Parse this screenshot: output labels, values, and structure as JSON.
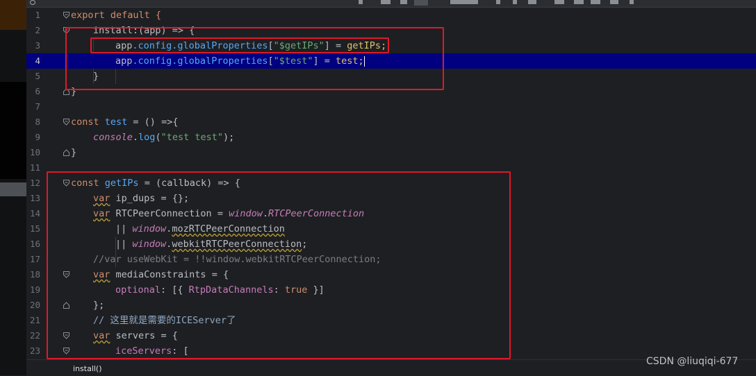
{
  "editor": {
    "current_line": 4,
    "lines": [
      {
        "n": "1"
      },
      {
        "n": "2"
      },
      {
        "n": "3"
      },
      {
        "n": "4"
      },
      {
        "n": "5"
      },
      {
        "n": "6"
      },
      {
        "n": "7"
      },
      {
        "n": "8"
      },
      {
        "n": "9"
      },
      {
        "n": "10"
      },
      {
        "n": "11"
      },
      {
        "n": "12"
      },
      {
        "n": "13"
      },
      {
        "n": "14"
      },
      {
        "n": "15"
      },
      {
        "n": "16"
      },
      {
        "n": "17"
      },
      {
        "n": "18"
      },
      {
        "n": "19"
      },
      {
        "n": "20"
      },
      {
        "n": "21"
      },
      {
        "n": "22"
      },
      {
        "n": "23"
      }
    ],
    "code": {
      "l1": [
        "export default {"
      ],
      "l2": [
        "install:(app) => {"
      ],
      "l3": [
        "app",
        ".config.",
        "globalProperties",
        "[",
        "\"$getIPs\"",
        "] = ",
        "getIPs",
        ";"
      ],
      "l4": [
        "app",
        ".config.",
        "globalProperties",
        "[",
        "\"$test\"",
        "] = ",
        "test",
        ";"
      ],
      "l5": [
        "}"
      ],
      "l6": [
        "}"
      ],
      "l8": [
        "const ",
        "test",
        " = () =>{"
      ],
      "l9": [
        "console",
        ".",
        "log",
        "(",
        "\"test test\"",
        ");"
      ],
      "l10": [
        "}"
      ],
      "l12": [
        "const ",
        "getIPs",
        " = (callback) => {"
      ],
      "l13": [
        "var",
        " ip_dups = {};"
      ],
      "l14": [
        "var",
        " RTCPeerConnection = ",
        "window",
        ".",
        "RTCPeerConnection"
      ],
      "l15": [
        "|| ",
        "window",
        ".",
        "mozRTCPeerConnection"
      ],
      "l16": [
        "|| ",
        "window",
        ".",
        "webkitRTCPeerConnection",
        ";"
      ],
      "l17": [
        "//var useWebKit = !!window.webkitRTCPeerConnection;"
      ],
      "l18": [
        "var",
        " mediaConstraints = {"
      ],
      "l19": [
        "optional",
        ": [{ ",
        "RtpDataChannels",
        ": ",
        "true",
        " }]"
      ],
      "l20": [
        "};"
      ],
      "l21": [
        "// 这里就是需要的ICEServer了"
      ],
      "l22": [
        "var",
        " servers = {"
      ],
      "l23": [
        "iceServers",
        ": ["
      ]
    }
  },
  "status": {
    "breadcrumb": "install()"
  },
  "watermark": "CSDN @liuqiqi-677",
  "colors": {
    "highlight_box": "#e0192b",
    "current_line_bg": "#000080"
  }
}
